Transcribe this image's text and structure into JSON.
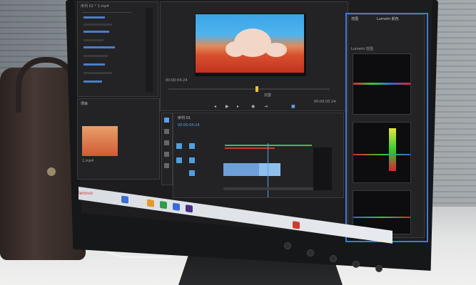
{
  "program_monitor": {
    "timecode_left": "00:00:04:24",
    "fit_label": "完整",
    "timecode_right": "00:00:05:24"
  },
  "effect_controls": {
    "header": "序列 01 * 1.mp4"
  },
  "timeline": {
    "tab_label": "序列 01",
    "timecode": "00:00:04:24"
  },
  "project_panel": {
    "tab_label": "项目",
    "clip_name": "1.mp4"
  },
  "lumetri_scopes": {
    "header": "Lumetri 范围",
    "tabs": [
      "范围",
      "Lumetri 颜色"
    ]
  },
  "taskbar": {
    "search_placeholder": ""
  },
  "monitor": {
    "brand": "lenovo"
  },
  "colors": {
    "selection_blue": "#3c7bd8",
    "sky": "#4fb4ee",
    "ground": "#c2311e"
  }
}
